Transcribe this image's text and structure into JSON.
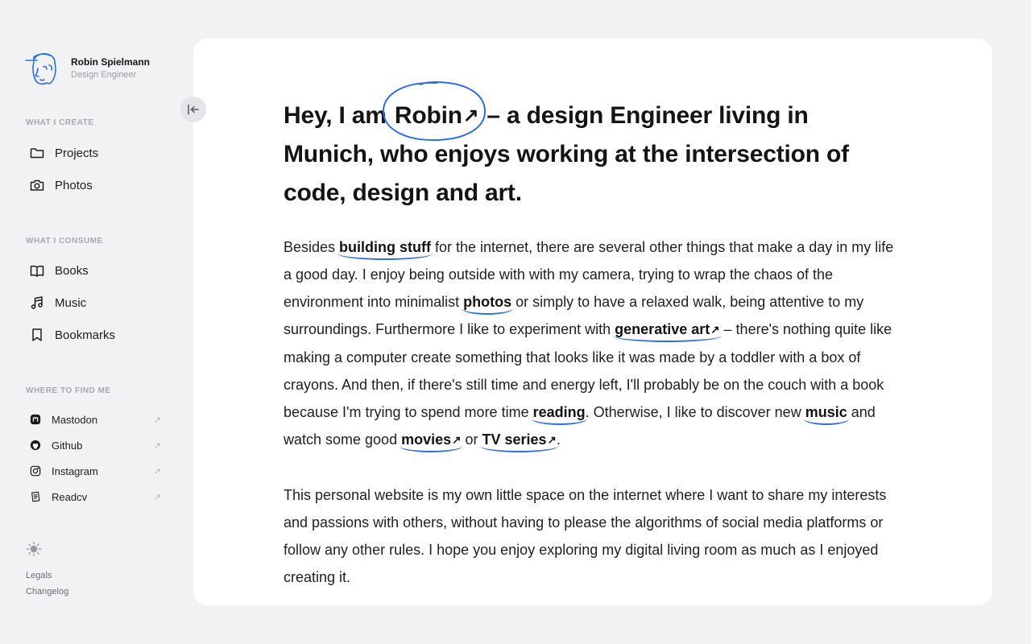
{
  "profile": {
    "name": "Robin Spielmann",
    "role": "Design Engineer"
  },
  "sidebar": {
    "create_title": "WHAT I CREATE",
    "create_items": [
      {
        "label": "Projects",
        "icon": "folder-icon"
      },
      {
        "label": "Photos",
        "icon": "camera-icon"
      }
    ],
    "consume_title": "WHAT I CONSUME",
    "consume_items": [
      {
        "label": "Books",
        "icon": "book-icon"
      },
      {
        "label": "Music",
        "icon": "music-icon"
      },
      {
        "label": "Bookmarks",
        "icon": "bookmark-icon"
      }
    ],
    "find_title": "WHERE TO FIND ME",
    "social_items": [
      {
        "label": "Mastodon",
        "icon": "mastodon-icon"
      },
      {
        "label": "Github",
        "icon": "github-icon"
      },
      {
        "label": "Instagram",
        "icon": "instagram-icon"
      },
      {
        "label": "Readcv",
        "icon": "readcv-icon"
      }
    ],
    "external_glyph": "↗",
    "footer": {
      "legals": "Legals",
      "changelog": "Changelog"
    }
  },
  "colors": {
    "accent": "#2f6ee0",
    "background": "#f1f2f4",
    "card": "#ffffff"
  },
  "intro": {
    "h_pre": "Hey, I am",
    "h_name": "Robin",
    "h_arrow": "↗",
    "h_post": " –  a design Engineer living in Munich, who enjoys working at the intersection of code, design and art."
  },
  "para1": {
    "t1": "Besides ",
    "l1": "building stuff",
    "t2": " for the internet, there are several other things that make a day in my life a good day. I enjoy being outside with with my camera, trying to wrap the chaos of the environment into minimalist ",
    "l2": "photos",
    "t3": " or simply to have a relaxed walk, being attentive to my surroundings. Furthermore I like to experiment with ",
    "l3": "generative art",
    "t4": " – there's nothing quite like making a computer create something that looks like it was made by a toddler with a box of crayons. And then, if there's still time and energy left, I'll probably be on the couch with a book because I'm trying to spend more time ",
    "l4": "reading",
    "t5": ". Otherwise, I like to discover new ",
    "l5": "music",
    "t6": " and watch some good ",
    "l6": "movies",
    "t7": "  or ",
    "l7": "TV series",
    "t8": "."
  },
  "para2": {
    "text": "This personal website is my own little space on the internet where I want to share my interests and passions with others, without having to please the algorithms of social media platforms or follow any other rules. I hope you enjoy exploring my digital living room as much as I enjoyed creating it."
  }
}
